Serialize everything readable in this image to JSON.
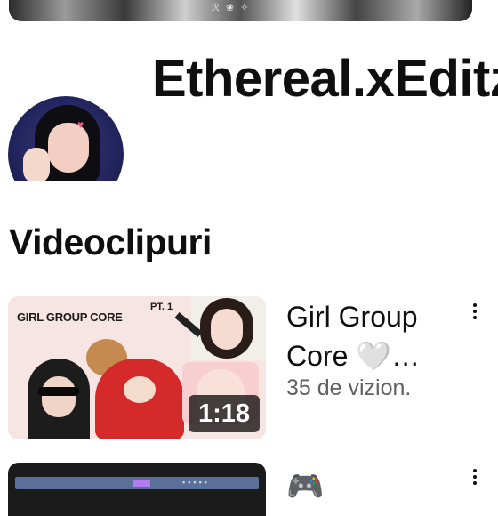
{
  "banner": {
    "text": "ℛ ❀ ✧"
  },
  "channel": {
    "name": "Ethereal.xEditz"
  },
  "section": {
    "title": "Videoclipuri"
  },
  "videos": [
    {
      "thumbnail_caption": "GIRL GROUP CORE",
      "thumbnail_tag": "PT. 1",
      "duration": "1:18",
      "title": "Girl Group Core 🤍…",
      "views": "35 de vizion."
    },
    {
      "title_icon": "🎮"
    }
  ],
  "icons": {
    "more": "kebab-menu-icon"
  }
}
